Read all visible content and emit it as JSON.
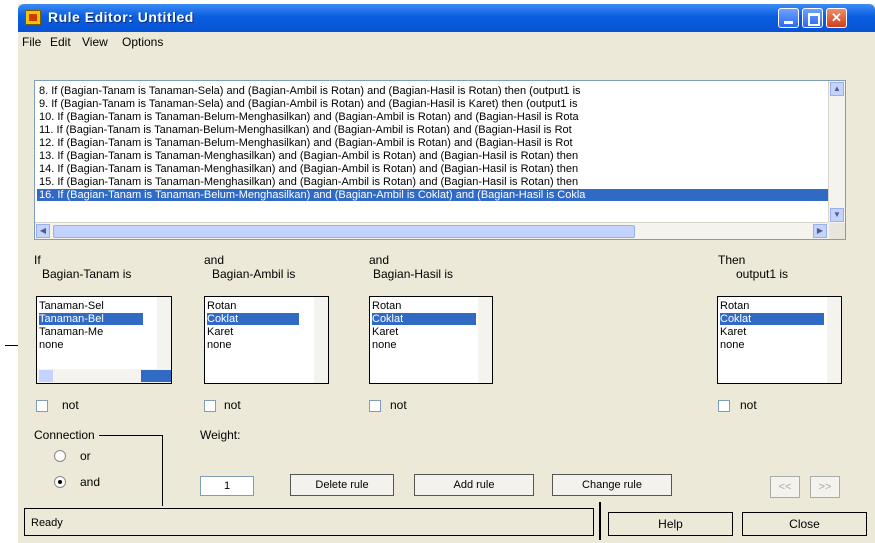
{
  "window": {
    "title": "Rule Editor: Untitled"
  },
  "menu": [
    "File",
    "Edit",
    "View",
    "Options"
  ],
  "rules": [
    "8. If (Bagian-Tanam is Tanaman-Sela) and (Bagian-Ambil is Rotan) and (Bagian-Hasil is Rotan) then (output1 is",
    "9. If (Bagian-Tanam is Tanaman-Sela) and (Bagian-Ambil is Rotan) and (Bagian-Hasil is Karet) then (output1 is",
    "10. If (Bagian-Tanam is Tanaman-Belum-Menghasilkan) and (Bagian-Ambil is Rotan) and (Bagian-Hasil is Rota",
    "11. If (Bagian-Tanam is Tanaman-Belum-Menghasilkan) and (Bagian-Ambil is Rotan) and (Bagian-Hasil is Rot",
    "12. If (Bagian-Tanam is Tanaman-Belum-Menghasilkan) and (Bagian-Ambil is Rotan) and (Bagian-Hasil is Rot",
    "13. If (Bagian-Tanam is Tanaman-Menghasilkan) and (Bagian-Ambil is Rotan) and (Bagian-Hasil is Rotan) then",
    "14. If (Bagian-Tanam is Tanaman-Menghasilkan) and (Bagian-Ambil is Rotan) and (Bagian-Hasil is Rotan) then",
    "15. If (Bagian-Tanam is Tanaman-Menghasilkan) and (Bagian-Ambil is Rotan) and (Bagian-Hasil is Rotan) then",
    "16. If (Bagian-Tanam is Tanaman-Belum-Menghasilkan) and (Bagian-Ambil is Coklat) and (Bagian-Hasil is Cokla"
  ],
  "selected_rule_index": 8,
  "antecedents": [
    {
      "connector": "If",
      "variable_label": "Bagian-Tanam is",
      "options": [
        "Tanaman-Sel",
        "Tanaman-Bel",
        "Tanaman-Me",
        "none"
      ],
      "selected": 1,
      "not_label": "not"
    },
    {
      "connector": "and",
      "variable_label": "Bagian-Ambil is",
      "options": [
        "Rotan",
        "Coklat",
        "Karet",
        "none"
      ],
      "selected": 1,
      "not_label": "not"
    },
    {
      "connector": "and",
      "variable_label": "Bagian-Hasil is",
      "options": [
        "Rotan",
        "Coklat",
        "Karet",
        "none"
      ],
      "selected": 1,
      "not_label": "not"
    }
  ],
  "consequent": {
    "connector": "Then",
    "variable_label": "output1 is",
    "options": [
      "Rotan",
      "Coklat",
      "Karet",
      "none"
    ],
    "selected": 1,
    "not_label": "not"
  },
  "connection": {
    "label": "Connection",
    "options": [
      "or",
      "and"
    ],
    "selected": 1
  },
  "weight": {
    "label": "Weight:",
    "value": "1"
  },
  "buttons": {
    "delete": "Delete rule",
    "add": "Add rule",
    "change": "Change rule",
    "prev": "<<",
    "next": ">>",
    "help": "Help",
    "close": "Close"
  },
  "status": "Ready"
}
